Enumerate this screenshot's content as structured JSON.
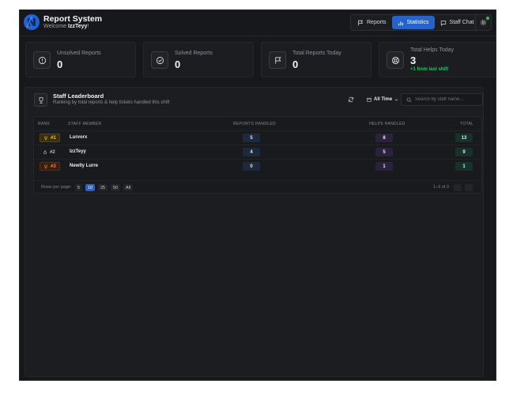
{
  "header": {
    "title": "Report System",
    "welcome_prefix": "Welcome ",
    "username": "IzzTeyy",
    "welcome_suffix": "!",
    "nav": [
      {
        "label": "Reports",
        "icon": "flag-icon"
      },
      {
        "label": "Statistics",
        "icon": "bar-chart-icon",
        "active": true
      },
      {
        "label": "Staff Chat",
        "icon": "chat-icon"
      }
    ],
    "settings_icon": "gear-icon",
    "online_dot_color": "#27c46a"
  },
  "stats": [
    {
      "label": "Unsolved Reports",
      "value": "0",
      "icon": "alert-circle-icon"
    },
    {
      "label": "Solved Reports",
      "value": "0",
      "icon": "check-circle-icon"
    },
    {
      "label": "Total Reports Today",
      "value": "0",
      "icon": "flag-icon"
    },
    {
      "label": "Total Helps Today",
      "value": "3",
      "icon": "lifebuoy-icon",
      "trend": "+1 from last shift"
    }
  ],
  "leaderboard": {
    "title": "Staff Leaderboard",
    "subtitle": "Ranking by total reports & help tickets handled this shift",
    "range": "All Time",
    "search_placeholder": "Search by staff name...",
    "columns": {
      "rank": "RANK",
      "member": "STAFF MEMBER",
      "reports": "REPORTS HANDLED",
      "helps": "HELPS HANDLED",
      "total": "TOTAL"
    },
    "rows": [
      {
        "rank": "#1",
        "name": "Lurvorx",
        "reports": "5",
        "helps": "8",
        "total": "13"
      },
      {
        "rank": "#2",
        "name": "IzzTeyy",
        "reports": "4",
        "helps": "5",
        "total": "9"
      },
      {
        "rank": "#3",
        "name": "Newlly Lurre",
        "reports": "0",
        "helps": "1",
        "total": "1"
      }
    ],
    "pager": {
      "label": "Rows per page:",
      "sizes": [
        "5",
        "10",
        "25",
        "50",
        "All"
      ],
      "active_size": "10",
      "range": "1–3 of 3"
    }
  },
  "colors": {
    "accent": "#2563c9",
    "background": "#17181b",
    "trend_green": "#2fbf71"
  }
}
